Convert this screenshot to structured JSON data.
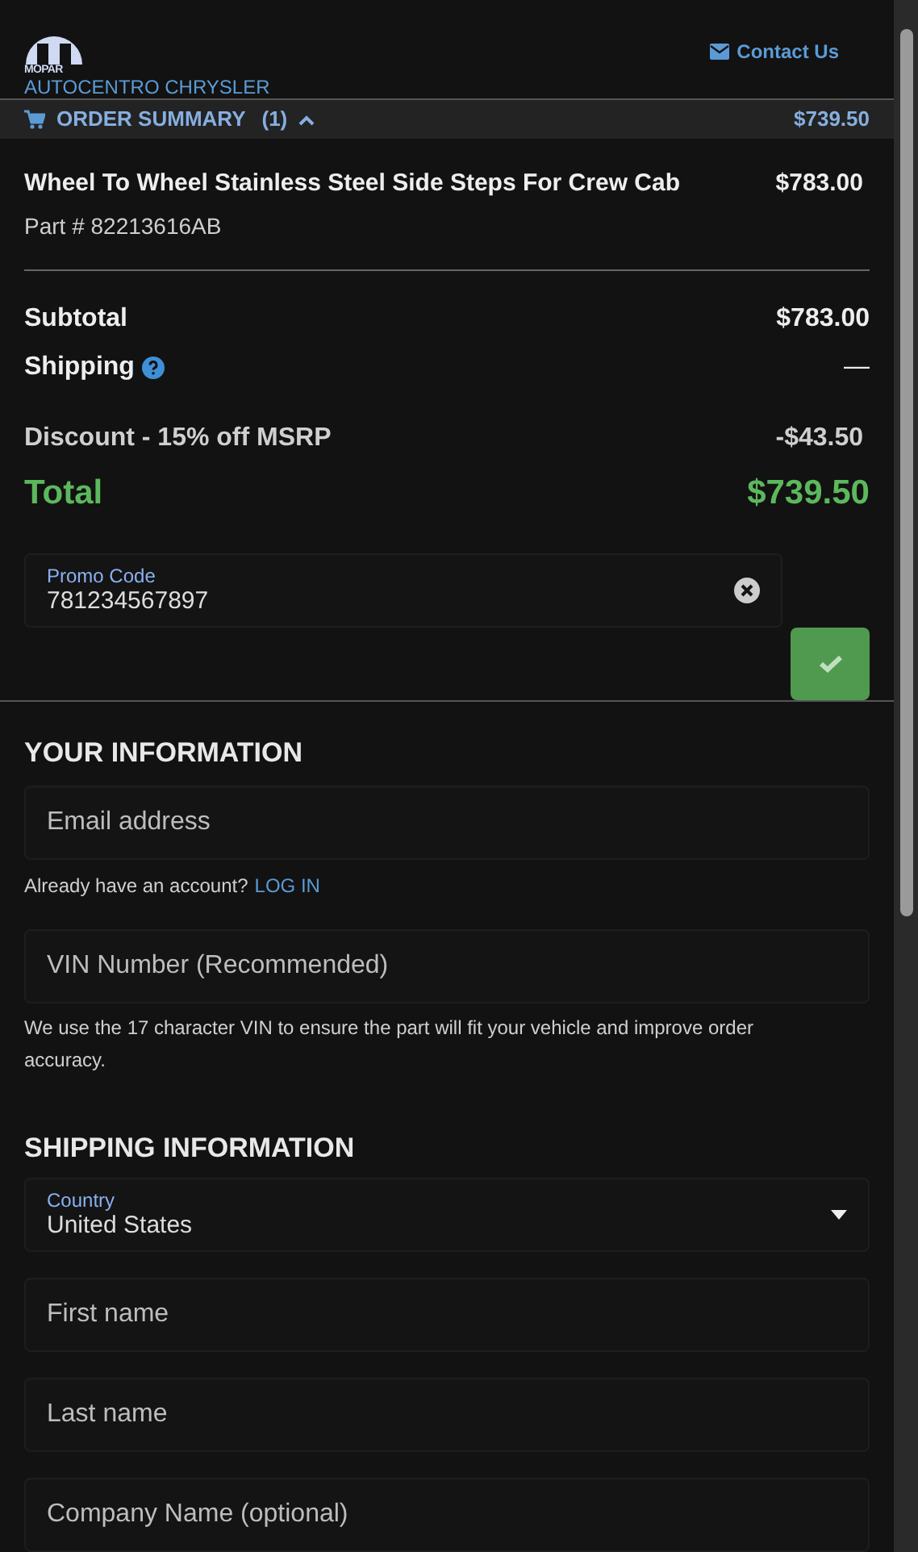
{
  "header": {
    "logo_text": "MOPAR",
    "dealer": "AUTOCENTRO CHRYSLER",
    "contact": "Contact Us"
  },
  "order_summary": {
    "label": "ORDER SUMMARY",
    "count": "(1)",
    "expanded": true,
    "total": "$739.50"
  },
  "item": {
    "name": "Wheel To Wheel Stainless Steel Side Steps For Crew Cab",
    "part": "Part # 82213616AB",
    "price": "$783.00"
  },
  "totals": [
    {
      "kind": "strong",
      "label": "Subtotal",
      "value": "$783.00"
    },
    {
      "kind": "help",
      "label": "Shipping",
      "value": "—"
    },
    {
      "kind": "plain",
      "label": "Discount - 15% off MSRP",
      "value": "-$43.50"
    },
    {
      "kind": "total",
      "label": "Total",
      "value": "$739.50"
    }
  ],
  "promo": {
    "label": "Promo Code",
    "value": "781234567897"
  },
  "your_information": {
    "title": "YOUR INFORMATION",
    "email": {
      "placeholder": "Email address"
    },
    "account_text": "Already have an account?",
    "login": "LOG IN",
    "vin": {
      "placeholder": "VIN Number (Recommended)"
    },
    "vin_note": "We use the 17 character VIN to ensure the part will fit your vehicle and improve order accuracy."
  },
  "shipping_information": {
    "title": "SHIPPING INFORMATION",
    "country": {
      "label": "Country",
      "value": "United States"
    },
    "fields": [
      {
        "placeholder": "First name"
      },
      {
        "placeholder": "Last name"
      },
      {
        "placeholder": "Company Name (optional)"
      }
    ]
  }
}
